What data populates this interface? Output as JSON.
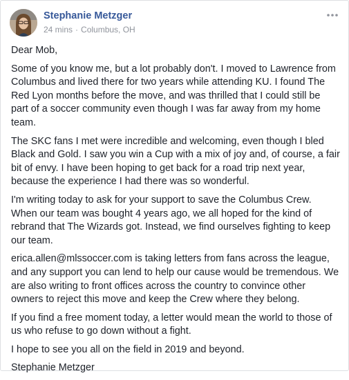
{
  "post": {
    "author_name": "Stephanie Metzger",
    "timestamp": "24 mins",
    "separator": "·",
    "location": "Columbus, OH",
    "icons": {
      "avatar": "profile-photo",
      "more": "ellipsis-icon",
      "location": "globe-icon"
    },
    "paragraphs": [
      "Dear Mob,",
      "Some of you know me, but a lot probably don't. I moved to Lawrence from Columbus and lived there for two years while attending KU. I found The Red Lyon months before the move, and was thrilled that I could still be part of a soccer community even though I was far away from my home team.",
      "The SKC fans I met were incredible and welcoming, even though I bled Black and Gold. I saw you win a Cup with a mix of joy and, of course, a fair bit of envy. I have been hoping to get back for a road trip next year, because the experience I had there was so wonderful.",
      "I'm writing today to ask for your support to save the Columbus Crew. When our team was bought 4 years ago, we all hoped for the kind of rebrand that The Wizards got. Instead, we find ourselves fighting to keep our team.",
      "erica.allen@mlssoccer.com is taking letters from fans across the league, and any support you can lend to help our cause would be tremendous. We are also writing to front offices across the country to convince other owners to reject this move and keep the Crew where they belong.",
      "If you find a free moment today, a letter would mean the world to those of us who refuse to go down without a fight.",
      "I hope to see you all on the field in 2019 and beyond.",
      "Stephanie Metzger"
    ]
  },
  "colors": {
    "author_link": "#365899",
    "meta_text": "#90949c",
    "body_text": "#1d2129",
    "card_border": "#dddfe2"
  }
}
